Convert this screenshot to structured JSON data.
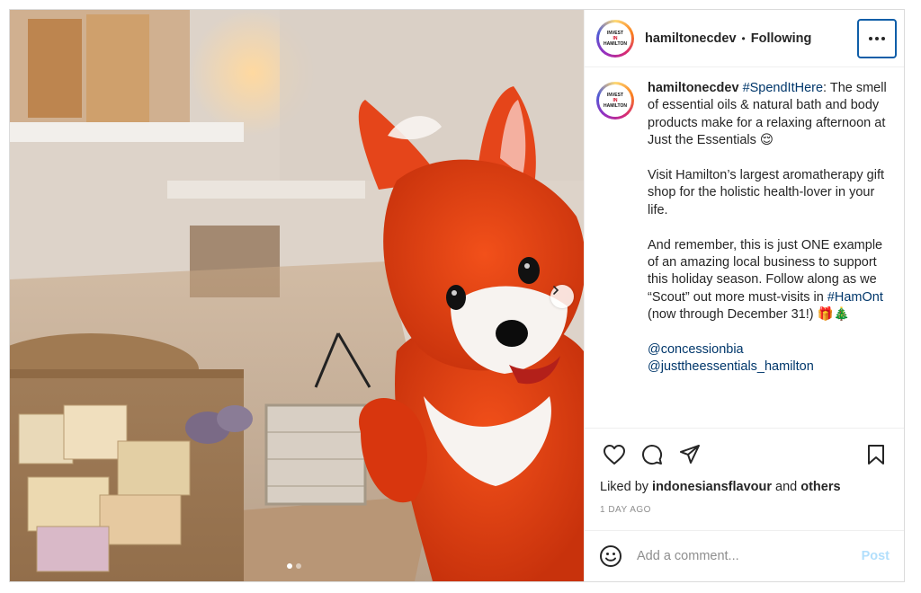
{
  "post": {
    "username": "hamiltonecdev",
    "separator": "•",
    "follow_status": "Following",
    "avatar_logo": "INVEST IN HAMILTON",
    "caption": {
      "username": "hamiltonecdev",
      "hashtag1": "#SpendItHere",
      "text1": ": The smell of essential oils & natural bath and body products make for a relaxing afternoon at Just the Essentials 😌",
      "para2": "Visit Hamilton’s largest aromatherapy gift shop for the holistic health-lover in your life.",
      "para3_start": "And remember, this is just ONE example of an amazing local business to support this holiday season. Follow along as we “Scout” out more must-visits in ",
      "hashtag2": "#HamOnt",
      "para3_end": " (now through December 31!) 🎁🎄",
      "mention1": "@concessionbia",
      "mention2": "@justtheessentials_hamilton"
    },
    "likes_prefix": "Liked by ",
    "likes_user": "indonesiansflavour",
    "likes_and": " and ",
    "likes_others": "others",
    "timestamp": "1 DAY AGO",
    "comment_placeholder": "Add a comment...",
    "post_button": "Post",
    "carousel": {
      "slide_count": 2,
      "current_slide": 1
    }
  },
  "icons": {
    "more": "more-horizontal-icon",
    "like": "heart-icon",
    "comment": "comment-bubble-icon",
    "share": "paper-plane-icon",
    "save": "bookmark-icon",
    "emoji": "smiley-icon",
    "next": "chevron-right-icon"
  },
  "colors": {
    "link": "#00376b",
    "post_button_disabled": "#b2dffc",
    "border": "#dbdbdb",
    "more_button_focus": "#0f5ea8"
  }
}
